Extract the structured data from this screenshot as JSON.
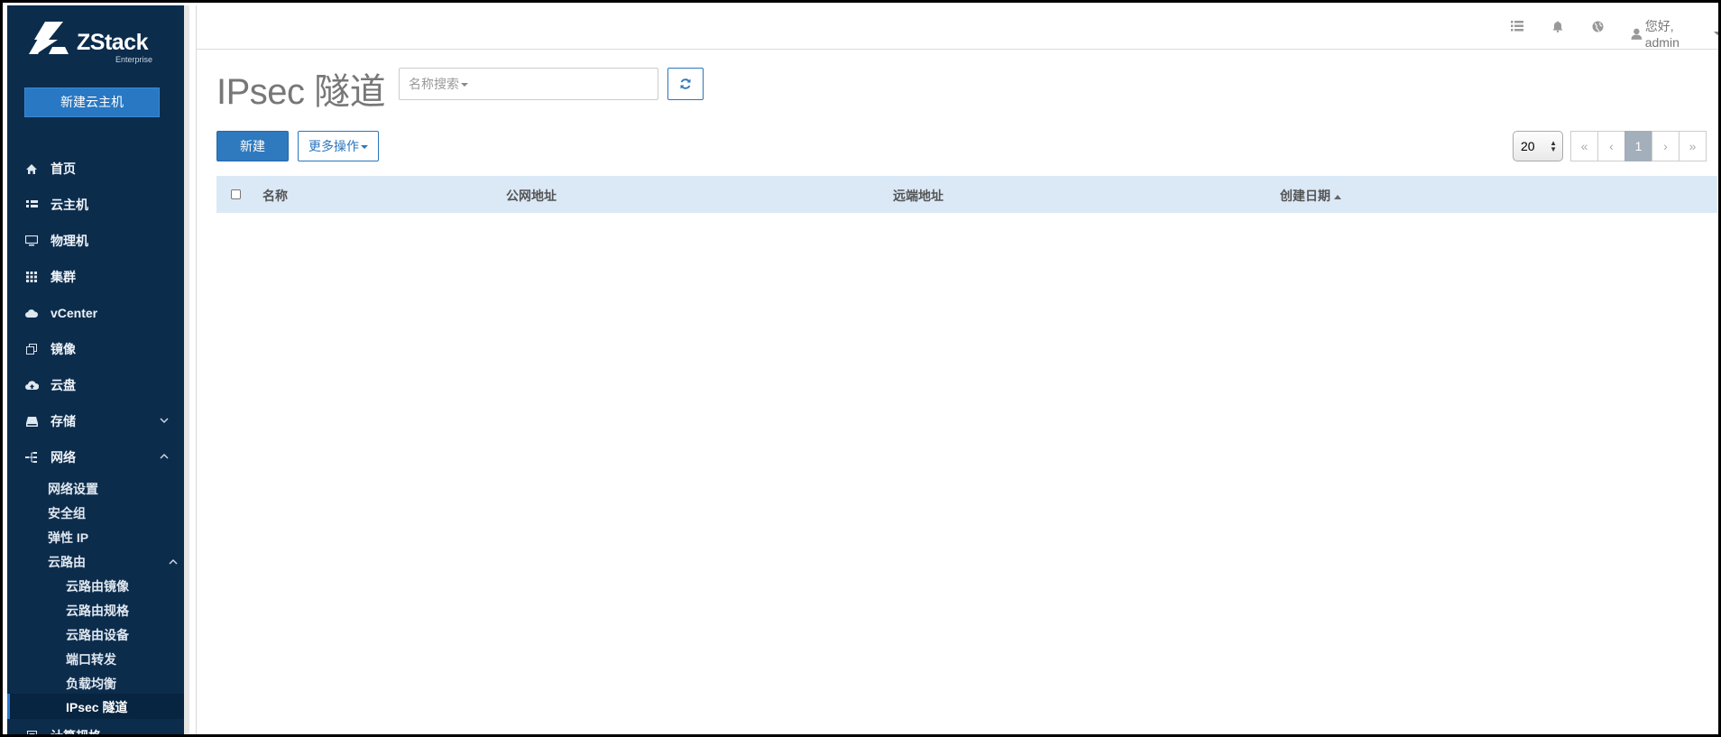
{
  "brand": {
    "name": "ZStack",
    "edition": "Enterprise"
  },
  "sidebar": {
    "new_vm_label": "新建云主机",
    "items": [
      {
        "label": "首页",
        "icon": "home-icon"
      },
      {
        "label": "云主机",
        "icon": "vm-grid-icon"
      },
      {
        "label": "物理机",
        "icon": "monitor-icon"
      },
      {
        "label": "集群",
        "icon": "cluster-grid-icon"
      },
      {
        "label": "vCenter",
        "icon": "cloud-icon"
      },
      {
        "label": "镜像",
        "icon": "image-copy-icon"
      },
      {
        "label": "云盘",
        "icon": "cloud-upload-icon"
      },
      {
        "label": "存储",
        "icon": "storage-icon"
      },
      {
        "label": "网络",
        "icon": "network-tree-icon"
      },
      {
        "label": "计算规格",
        "icon": "spec-icon"
      }
    ],
    "network_sub": [
      "网络设置",
      "安全组",
      "弹性 IP",
      "云路由"
    ],
    "router_sub": [
      "云路由镜像",
      "云路由规格",
      "云路由设备",
      "端口转发",
      "负载均衡",
      "IPsec 隧道"
    ]
  },
  "topbar": {
    "user_greeting": "您好, admin"
  },
  "main": {
    "title": "IPsec 隧道",
    "search_placeholder": "名称搜索",
    "new_button": "新建",
    "more_button": "更多操作",
    "page_size": "20",
    "pager": {
      "first": "«",
      "prev": "‹",
      "current": "1",
      "next": "›",
      "last": "»"
    },
    "columns": [
      "名称",
      "公网地址",
      "远端地址",
      "创建日期"
    ]
  },
  "colors": {
    "sidebar_bg": "#0c2c4c",
    "primary": "#2f7abf",
    "table_header_bg": "#dbe9f7"
  }
}
